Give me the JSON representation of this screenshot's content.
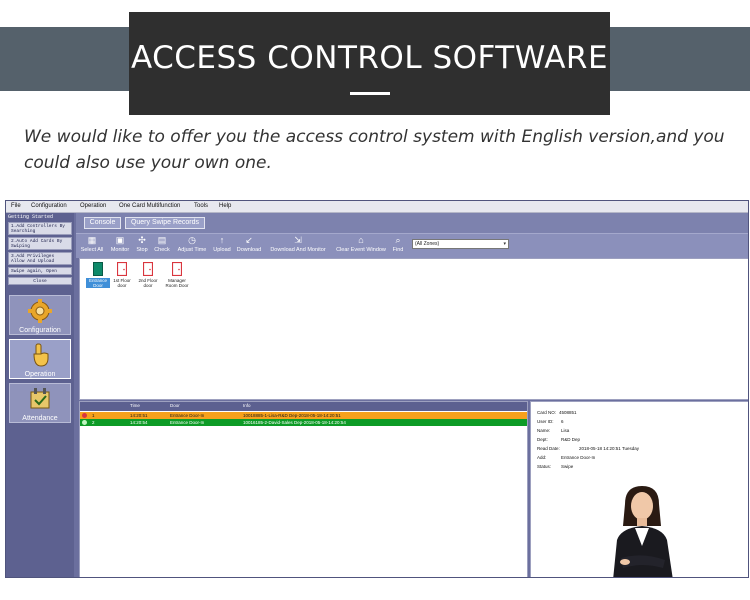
{
  "banner": {
    "title": "ACCESS CONTROL SOFTWARE",
    "intro": "We would like to offer you the access control system with English version,and you could also use your own one."
  },
  "menu": [
    "File",
    "Configuration",
    "Operation",
    "One Card Multifunction",
    "Tools",
    "Help"
  ],
  "getting_started": {
    "title": "Getting Started",
    "items": [
      "1.Add Controllers By Searching",
      "2.Auto Add Cards By Swiping",
      "3.Add Privileges Allow And Upload",
      "Swipe again, Open",
      "Close"
    ]
  },
  "nav": [
    {
      "label": "Configuration",
      "icon": "gear-icon"
    },
    {
      "label": "Operation",
      "icon": "hand-pointer-icon"
    },
    {
      "label": "Attendance",
      "icon": "attendance-icon"
    }
  ],
  "tabs": [
    "Console",
    "Query Swipe Records"
  ],
  "toolbar": [
    {
      "label": "Select All",
      "icon": "select-all-icon"
    },
    {
      "label": "Monitor",
      "icon": "monitor-icon"
    },
    {
      "label": "Stop",
      "icon": "stop-icon"
    },
    {
      "label": "Check",
      "icon": "check-icon"
    },
    {
      "label": "Adjust Time",
      "icon": "clock-icon"
    },
    {
      "label": "Upload",
      "icon": "upload-icon"
    },
    {
      "label": "Download",
      "icon": "download-icon"
    },
    {
      "label": "Download And Monitor",
      "icon": "download-monitor-icon"
    },
    {
      "label": "Clear Event Window",
      "icon": "clear-icon"
    },
    {
      "label": "Find",
      "icon": "search-icon"
    }
  ],
  "zone_select": {
    "value": "(All Zones)"
  },
  "doors": [
    {
      "label": "Entrance Door",
      "selected": true
    },
    {
      "label": "1st Floor door",
      "selected": false
    },
    {
      "label": "2nd Floor door",
      "selected": false
    },
    {
      "label": "Manager Room Door",
      "selected": false
    }
  ],
  "log": {
    "columns": [
      "",
      "Time",
      "Door",
      "Info"
    ],
    "rows": [
      {
        "index": "1",
        "time": "14:20:51",
        "door": "Entrance Door-In",
        "info": "10018885-1-Lisa-R&D Dep-2018-05-18-14:20:51",
        "status": "denied"
      },
      {
        "index": "2",
        "time": "14:20:54",
        "door": "Entrance Door-In",
        "info": "10016185-2-David-Sales Dep-2018-05-18-14:20:54",
        "status": "allowed"
      }
    ]
  },
  "detail": {
    "fields": [
      {
        "label": "Card NO:",
        "value": "4508851"
      },
      {
        "label": "User ID:",
        "value": "6"
      },
      {
        "label": "Name:",
        "value": "Lisa"
      },
      {
        "label": "Dept:",
        "value": "R&D Dep"
      },
      {
        "label": "Read Date:",
        "value": "2018-05-18 14:20:51 Tuesday"
      },
      {
        "label": "Add:",
        "value": "Entrance Door-In"
      },
      {
        "label": "Status:",
        "value": "Swipe"
      }
    ]
  },
  "colors": {
    "band": "#55616b",
    "title_box": "#2f2f2f",
    "app_bg": "#6b6f9e",
    "row_denied": "#f6a11c",
    "row_allowed": "#0d9b26",
    "door_icon": "#d9363e",
    "door_selected_icon": "#0e8a6a"
  }
}
